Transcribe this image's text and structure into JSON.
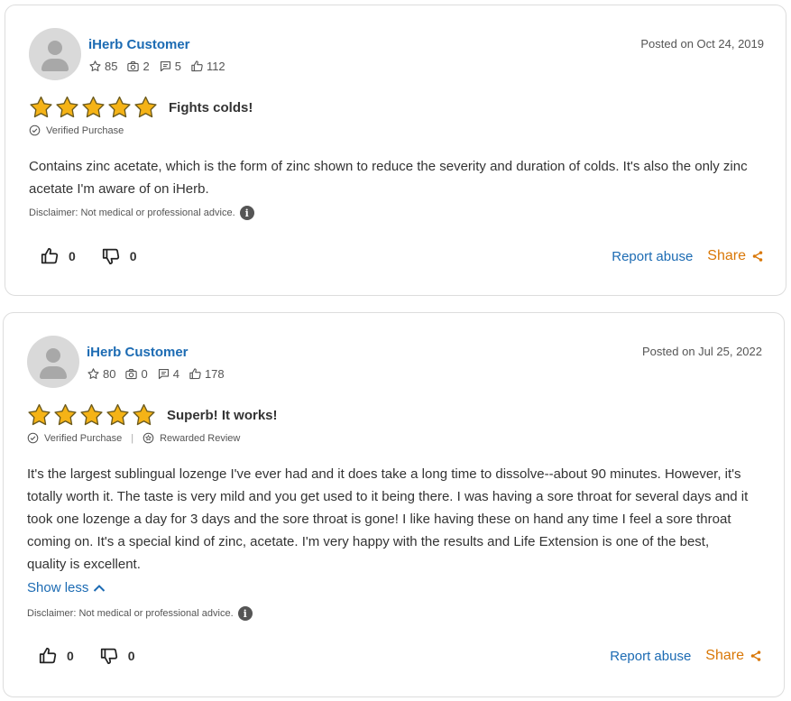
{
  "colors": {
    "link": "#1c6bb3",
    "share": "#d97706",
    "star": "#f5b316",
    "star_outline": "#6b5a1e"
  },
  "reviews": [
    {
      "author": "iHerb Customer",
      "stats": {
        "stars": "85",
        "photos": "2",
        "reviews": "5",
        "helpful": "112"
      },
      "posted": "Posted on Oct 24, 2019",
      "rating": 5,
      "title": "Fights colds!",
      "verified": "Verified Purchase",
      "text": "Contains zinc acetate, which is the form of zinc shown to reduce the severity and duration of colds. It's also the only zinc acetate I'm aware of on iHerb.",
      "disclaimer": "Disclaimer: Not medical or professional advice.",
      "upvotes": "0",
      "downvotes": "0",
      "report": "Report abuse",
      "share": "Share"
    },
    {
      "author": "iHerb Customer",
      "stats": {
        "stars": "80",
        "photos": "0",
        "reviews": "4",
        "helpful": "178"
      },
      "posted": "Posted on Jul 25, 2022",
      "rating": 5,
      "title": "Superb! It works!",
      "verified": "Verified Purchase",
      "rewarded": "Rewarded Review",
      "text": "It's the largest sublingual lozenge I've ever had and it does take a long time to dissolve--about 90 minutes. However, it's totally worth it. The taste is very mild and you get used to it being there. I was having a sore throat for several days and it took one lozenge a day for 3 days and the sore throat is gone! I like having these on hand any time I feel a sore throat coming on. It's a special kind of zinc, acetate. I'm very happy with the results and Life Extension is one of the best, quality is excellent.",
      "show_less": "Show less",
      "disclaimer": "Disclaimer: Not medical or professional advice.",
      "upvotes": "0",
      "downvotes": "0",
      "report": "Report abuse",
      "share": "Share"
    }
  ]
}
